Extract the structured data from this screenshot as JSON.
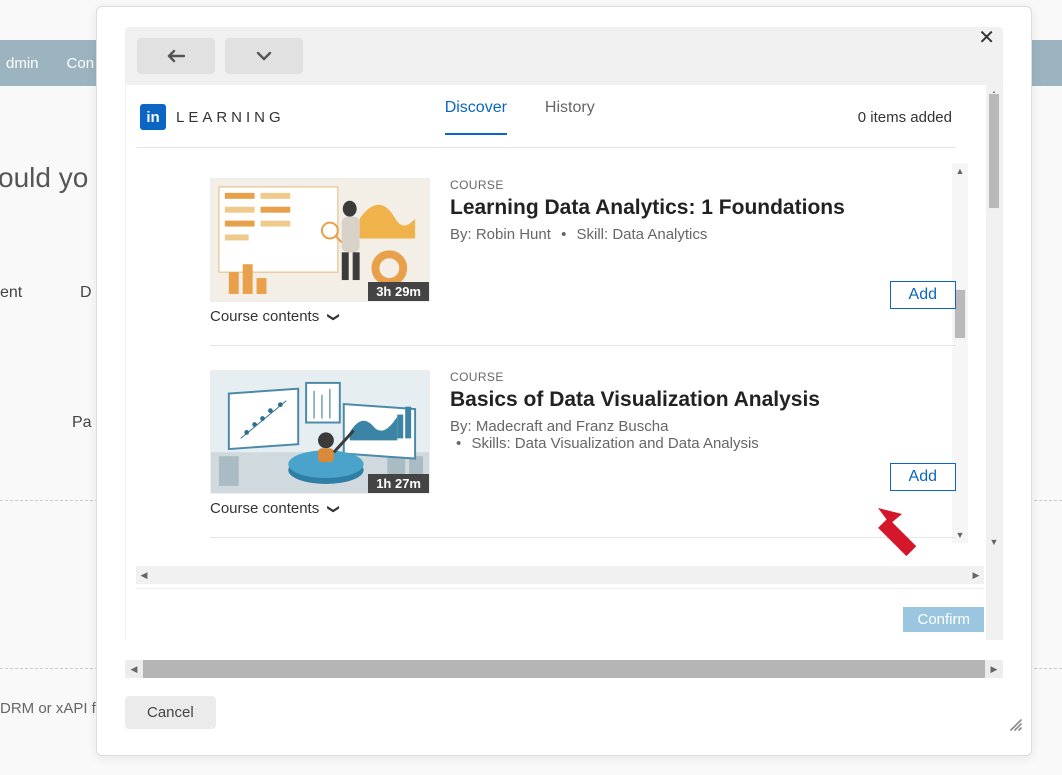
{
  "bg": {
    "nav_admin": "dmin",
    "nav_content": "Con",
    "heading_fragment": "ould yo",
    "left_frag1": "ent",
    "left_d": "D",
    "left_pa": "Pa",
    "bottom": "DRM or xAPI fi"
  },
  "modal": {
    "close": "✕",
    "brand_letters": "LEARNING",
    "in_badge": "in",
    "tabs": {
      "discover": "Discover",
      "history": "History"
    },
    "items_added": "0 items added",
    "confirm": "Confirm",
    "cancel": "Cancel"
  },
  "courses": [
    {
      "kicker": "COURSE",
      "title": "Learning Data Analytics: 1 Foundations",
      "byline_by": "By: Robin Hunt",
      "byline_skill": "Skill: Data Analytics",
      "duration": "3h 29m",
      "contents": "Course contents",
      "add": "Add"
    },
    {
      "kicker": "COURSE",
      "title": "Basics of Data Visualization Analysis",
      "byline_by": "By: Madecraft and Franz Buscha",
      "byline_skill": "Skills: Data Visualization and Data Analysis",
      "duration": "1h 27m",
      "contents": "Course contents",
      "add": "Add"
    }
  ]
}
